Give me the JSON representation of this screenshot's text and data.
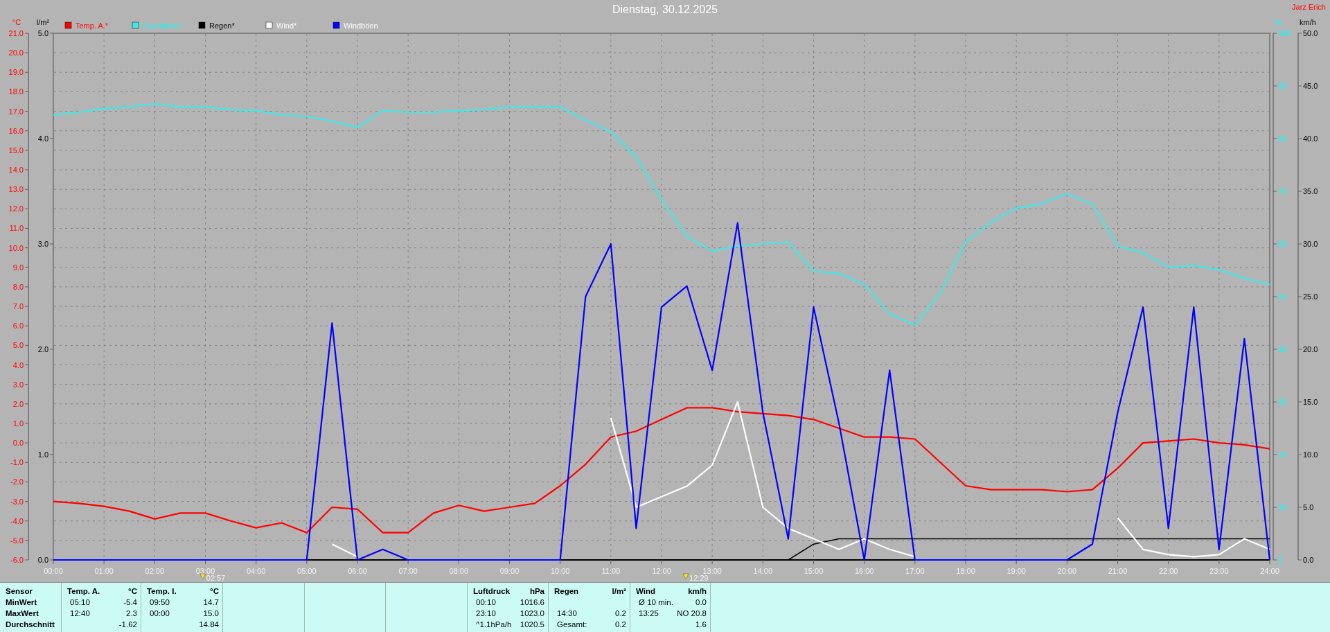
{
  "title": "Dienstag, 30.12.2025",
  "author": "Jarz Erich",
  "charts": [
    {
      "chart_data": {
        "type": "line",
        "xlim": [
          0,
          24
        ],
        "ylabel": "°C",
        "ylim": [
          -6,
          21
        ],
        "y2label": "l/m²",
        "y2lim": [
          0,
          5
        ],
        "x": [
          0,
          0.5,
          1,
          1.5,
          2,
          2.5,
          3,
          3.5,
          4,
          4.5,
          5,
          5.5,
          6,
          6.5,
          7,
          7.5,
          8,
          8.5,
          9,
          9.5,
          10,
          10.5,
          11,
          11.5,
          12,
          12.5,
          13,
          13.5,
          14,
          14.5,
          15,
          15.5,
          16,
          16.5,
          17,
          17.5,
          18,
          18.5,
          19,
          19.5,
          20,
          20.5,
          21,
          21.5,
          22,
          22.5,
          23,
          23.5,
          24
        ],
        "xticks": [
          {
            "value": 0,
            "label": "00:00"
          },
          {
            "value": 1,
            "label": "01:00"
          },
          {
            "value": 2,
            "label": "02:00"
          },
          {
            "value": 3,
            "label": "03:00"
          },
          {
            "value": 4,
            "label": "04:00"
          },
          {
            "value": 5,
            "label": "05:00"
          },
          {
            "value": 6,
            "label": "06:00"
          },
          {
            "value": 7,
            "label": "07:00"
          },
          {
            "value": 8,
            "label": "08:00"
          },
          {
            "value": 9,
            "label": "09:00"
          },
          {
            "value": 10,
            "label": "10:00"
          },
          {
            "value": 11,
            "label": "11:00"
          },
          {
            "value": 12,
            "label": "12:00"
          },
          {
            "value": 13,
            "label": "13:00"
          },
          {
            "value": 14,
            "label": "14:00"
          },
          {
            "value": 15,
            "label": "15:00"
          },
          {
            "value": 16,
            "label": "16:00"
          },
          {
            "value": 17,
            "label": "17:00"
          },
          {
            "value": 18,
            "label": "18:00"
          },
          {
            "value": 19,
            "label": "19:00"
          },
          {
            "value": 20,
            "label": "20:00"
          },
          {
            "value": 21,
            "label": "21:00"
          },
          {
            "value": 22,
            "label": "22:00"
          },
          {
            "value": 23,
            "label": "23:00"
          },
          {
            "value": 24,
            "label": "24:00"
          }
        ],
        "yticks": [
          {
            "value": -6,
            "label": "-6.0"
          },
          {
            "value": -5,
            "label": "-5.0"
          },
          {
            "value": -4,
            "label": "-4.0"
          },
          {
            "value": -3,
            "label": "-3.0"
          },
          {
            "value": -2,
            "label": "-2.0"
          },
          {
            "value": -1,
            "label": "-1.0"
          },
          {
            "value": 0,
            "label": "0.0"
          },
          {
            "value": 1,
            "label": "1.0"
          },
          {
            "value": 2,
            "label": "2.0"
          },
          {
            "value": 3,
            "label": "3.0"
          },
          {
            "value": 4,
            "label": "4.0"
          },
          {
            "value": 5,
            "label": "5.0"
          },
          {
            "value": 6,
            "label": "6.0"
          },
          {
            "value": 7,
            "label": "7.0"
          },
          {
            "value": 8,
            "label": "8.0"
          },
          {
            "value": 9,
            "label": "9.0"
          },
          {
            "value": 10,
            "label": "10.0"
          },
          {
            "value": 11,
            "label": "11.0"
          },
          {
            "value": 12,
            "label": "12.0"
          },
          {
            "value": 13,
            "label": "13.0"
          },
          {
            "value": 14,
            "label": "14.0"
          },
          {
            "value": 15,
            "label": "15.0"
          },
          {
            "value": 16,
            "label": "16.0"
          },
          {
            "value": 17,
            "label": "17.0"
          },
          {
            "value": 18,
            "label": "18.0"
          },
          {
            "value": 19,
            "label": "19.0"
          },
          {
            "value": 20,
            "label": "20.0"
          },
          {
            "value": 21,
            "label": "21.0"
          }
        ],
        "y2ticks": [
          {
            "value": 0,
            "label": "0.0"
          },
          {
            "value": 1,
            "label": "1.0"
          },
          {
            "value": 2,
            "label": "2.0"
          },
          {
            "value": 3,
            "label": "3.0"
          },
          {
            "value": 4,
            "label": "4.0"
          },
          {
            "value": 5,
            "label": "5.0"
          }
        ],
        "series": [
          {
            "name": "Temp. A.*",
            "color": "#ff0000",
            "values": [
              -3.0,
              -3.1,
              -3.25,
              -3.5,
              -3.9,
              -3.6,
              -3.6,
              -4.0,
              -4.35,
              -4.1,
              -4.6,
              -3.3,
              -3.4,
              -4.6,
              -4.6,
              -3.6,
              -3.2,
              -3.5,
              -3.3,
              -3.1,
              -2.2,
              -1.1,
              0.3,
              0.6,
              1.2,
              1.8,
              1.8,
              1.6,
              1.5,
              1.4,
              1.2,
              0.75,
              0.3,
              0.3,
              0.2,
              -1.0,
              -2.2,
              -2.4,
              -2.4,
              -2.4,
              -2.5,
              -2.4,
              -1.3,
              0.0,
              0.1,
              0.2,
              0.0,
              -0.1,
              -0.3
            ]
          },
          {
            "name": "Regen*",
            "color": "#000000",
            "axis": "y2",
            "values": [
              null,
              null,
              null,
              null,
              null,
              null,
              null,
              null,
              null,
              null,
              null,
              null,
              null,
              null,
              null,
              null,
              null,
              null,
              null,
              null,
              null,
              null,
              null,
              null,
              null,
              null,
              null,
              null,
              null,
              0,
              0.15,
              0.2,
              0.2,
              0.2,
              0.2,
              0.2,
              0.2,
              0.2,
              0.2,
              0.2,
              0.2,
              0.2,
              0.2,
              0.2,
              0.2,
              0.2,
              0.2,
              0.2,
              0.2
            ]
          }
        ],
        "grid": true,
        "legend": "top",
        "annotations": [
          "02:57",
          "12:29"
        ]
      }
    },
    {
      "chart_data": {
        "type": "line",
        "xlim": [
          0,
          24
        ],
        "ylabel": "%",
        "ylim": [
          0,
          100
        ],
        "y2label": "km/h",
        "y2lim": [
          0,
          50
        ],
        "x": [
          0,
          0.5,
          1,
          1.5,
          2,
          2.5,
          3,
          3.5,
          4,
          4.5,
          5,
          5.5,
          6,
          6.5,
          7,
          7.5,
          8,
          8.5,
          9,
          9.5,
          10,
          10.5,
          11,
          11.5,
          12,
          12.5,
          13,
          13.5,
          14,
          14.5,
          15,
          15.5,
          16,
          16.5,
          17,
          17.5,
          18,
          18.5,
          19,
          19.5,
          20,
          20.5,
          21,
          21.5,
          22,
          22.5,
          23,
          23.5,
          24
        ],
        "yticks": [
          {
            "value": 0,
            "label": "0"
          },
          {
            "value": 10,
            "label": "10"
          },
          {
            "value": 20,
            "label": "20"
          },
          {
            "value": 30,
            "label": "30"
          },
          {
            "value": 40,
            "label": "40"
          },
          {
            "value": 50,
            "label": "50"
          },
          {
            "value": 60,
            "label": "60"
          },
          {
            "value": 70,
            "label": "70"
          },
          {
            "value": 80,
            "label": "80"
          },
          {
            "value": 90,
            "label": "90"
          },
          {
            "value": 100,
            "label": "100"
          }
        ],
        "y2ticks": [
          {
            "value": 0,
            "label": "0.0"
          },
          {
            "value": 5,
            "label": "5.0"
          },
          {
            "value": 10,
            "label": "10.0"
          },
          {
            "value": 15,
            "label": "15.0"
          },
          {
            "value": 20,
            "label": "20.0"
          },
          {
            "value": 25,
            "label": "25.0"
          },
          {
            "value": 30,
            "label": "30.0"
          },
          {
            "value": 35,
            "label": "35.0"
          },
          {
            "value": 40,
            "label": "40.0"
          },
          {
            "value": 45,
            "label": "45.0"
          },
          {
            "value": 50,
            "label": "50.0"
          }
        ],
        "series": [
          {
            "name": "Feuchte A.*",
            "color": "#40e8e8",
            "values": [
              84.5,
              85,
              85.7,
              86,
              86.6,
              86,
              86,
              85.5,
              85.3,
              84.5,
              84.2,
              83.3,
              82.1,
              85.3,
              85,
              85,
              85.3,
              85.5,
              86,
              86,
              86,
              83.5,
              81.3,
              76.5,
              68.4,
              61.5,
              58.6,
              59.6,
              60,
              60.4,
              54.8,
              54.4,
              52.3,
              46.7,
              44.6,
              50.7,
              60.4,
              64.1,
              66.8,
              67.6,
              69.5,
              67.6,
              59.6,
              58.3,
              55.6,
              55.9,
              55.1,
              53.5,
              52.3
            ]
          },
          {
            "name": "Wind*",
            "color": "#ffffff",
            "axis": "y2",
            "values": [
              null,
              null,
              null,
              null,
              null,
              null,
              null,
              null,
              null,
              null,
              null,
              1.5,
              0.3,
              null,
              null,
              null,
              null,
              null,
              null,
              null,
              null,
              null,
              13.5,
              5,
              6,
              7,
              9,
              15,
              5,
              3,
              2,
              1,
              2,
              1,
              0.3,
              null,
              null,
              null,
              null,
              null,
              null,
              null,
              4,
              1,
              0.5,
              0.3,
              0.5,
              2,
              1
            ]
          },
          {
            "name": "Windböen",
            "color": "#0000ff",
            "axis": "y2",
            "values": [
              0,
              0,
              0,
              0,
              0,
              0,
              0,
              0,
              0,
              0,
              0,
              22.5,
              0,
              1,
              0,
              0,
              0,
              0,
              0,
              0,
              0,
              25,
              30,
              3,
              24,
              26,
              18,
              32,
              14,
              2,
              24,
              13,
              0,
              18,
              0,
              0,
              0,
              0,
              0,
              0,
              0,
              1.5,
              14,
              24,
              3,
              24,
              1,
              21,
              0
            ]
          }
        ]
      }
    }
  ],
  "table": {
    "row_labels": [
      "Sensor",
      "MinWert",
      "MaxWert",
      "Durchschnitt"
    ],
    "columns": [
      {
        "kind": "data",
        "header": "Temp. A.",
        "unit": "°C",
        "rows": [
          {
            "time": "05:10",
            "value": "-5.4"
          },
          {
            "time": "12:40",
            "value": "2.3"
          },
          {
            "value": "-1.62"
          }
        ]
      },
      {
        "kind": "data",
        "header": "Temp. I.",
        "unit": "°C",
        "rows": [
          {
            "time": "09:50",
            "value": "14.7"
          },
          {
            "time": "00:00",
            "value": "15.0"
          },
          {
            "value": "14.84"
          }
        ]
      },
      {
        "kind": "empty"
      },
      {
        "kind": "empty"
      },
      {
        "kind": "empty"
      },
      {
        "kind": "data",
        "header": "Luftdruck",
        "unit": "hPa",
        "rows": [
          {
            "time": "00:10",
            "value": "1016.6"
          },
          {
            "time": "23:10",
            "value": "1023.0"
          },
          {
            "time": "^1.1hPa/h",
            "value": "1020.5"
          }
        ]
      },
      {
        "kind": "data",
        "header": "Regen",
        "unit": "l/m²",
        "rows": [
          {},
          {
            "time": "14:30",
            "value": "0.2"
          },
          {
            "time": "Gesamt:",
            "value": "0.2"
          }
        ]
      },
      {
        "kind": "data",
        "header": "Wind",
        "unit": "km/h",
        "rows": [
          {
            "time": "Ø 10 min.",
            "value": "0.0"
          },
          {
            "time": "13:25",
            "value": "NO 20.8"
          },
          {
            "value": "1.6"
          }
        ]
      }
    ]
  }
}
